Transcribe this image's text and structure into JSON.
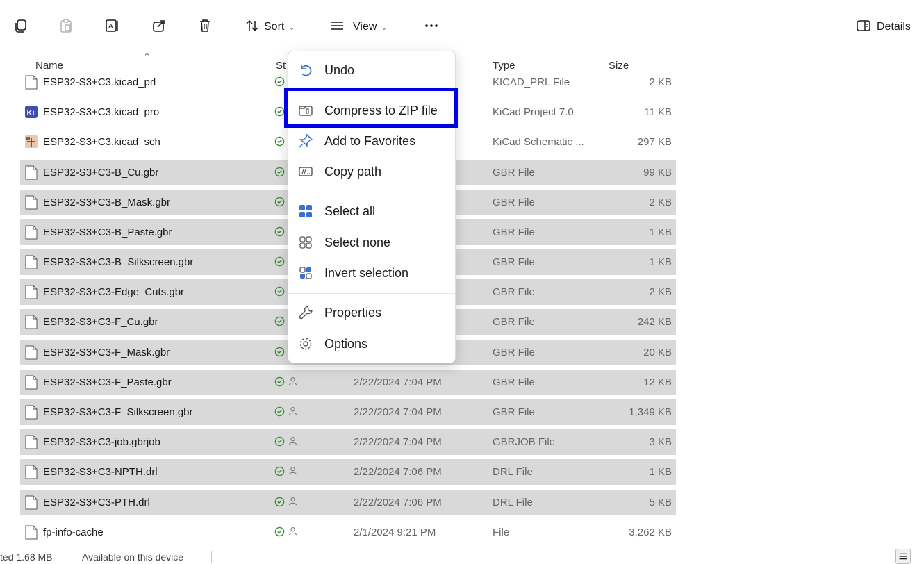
{
  "toolbar": {
    "sort_label": "Sort",
    "view_label": "View",
    "more_label": "...",
    "details_label": "Details",
    "icons": [
      "copy-icon",
      "paste-icon",
      "rename-icon",
      "share-icon",
      "delete-icon",
      "sort-icon",
      "view-icon",
      "more-icon",
      "details-pane-icon"
    ]
  },
  "columns": {
    "name": "Name",
    "status": "St",
    "type": "Type",
    "size": "Size"
  },
  "files": [
    {
      "name": "ESP32-S3+C3.kicad_prl",
      "date": "",
      "type": "KICAD_PRL File",
      "size": "2 KB",
      "selected": false,
      "icon": "blank-file-icon"
    },
    {
      "name": "ESP32-S3+C3.kicad_pro",
      "date": "",
      "type": "KiCad Project 7.0",
      "size": "11 KB",
      "selected": false,
      "icon": "kicad-project-icon"
    },
    {
      "name": "ESP32-S3+C3.kicad_sch",
      "date": "",
      "type": "KiCad Schematic ...",
      "size": "297 KB",
      "selected": false,
      "icon": "kicad-schematic-icon"
    },
    {
      "name": "ESP32-S3+C3-B_Cu.gbr",
      "date": "",
      "type": "GBR File",
      "size": "99 KB",
      "selected": true,
      "icon": "file-icon"
    },
    {
      "name": "ESP32-S3+C3-B_Mask.gbr",
      "date": "",
      "type": "GBR File",
      "size": "2 KB",
      "selected": true,
      "icon": "file-icon"
    },
    {
      "name": "ESP32-S3+C3-B_Paste.gbr",
      "date": "",
      "type": "GBR File",
      "size": "1 KB",
      "selected": true,
      "icon": "file-icon"
    },
    {
      "name": "ESP32-S3+C3-B_Silkscreen.gbr",
      "date": "",
      "type": "GBR File",
      "size": "1 KB",
      "selected": true,
      "icon": "file-icon"
    },
    {
      "name": "ESP32-S3+C3-Edge_Cuts.gbr",
      "date": "",
      "type": "GBR File",
      "size": "2 KB",
      "selected": true,
      "icon": "file-icon"
    },
    {
      "name": "ESP32-S3+C3-F_Cu.gbr",
      "date": "",
      "type": "GBR File",
      "size": "242 KB",
      "selected": true,
      "icon": "file-icon"
    },
    {
      "name": "ESP32-S3+C3-F_Mask.gbr",
      "date": "",
      "type": "GBR File",
      "size": "20 KB",
      "selected": true,
      "icon": "file-icon"
    },
    {
      "name": "ESP32-S3+C3-F_Paste.gbr",
      "date": "2/22/2024 7:04 PM",
      "type": "GBR File",
      "size": "12 KB",
      "selected": true,
      "icon": "file-icon"
    },
    {
      "name": "ESP32-S3+C3-F_Silkscreen.gbr",
      "date": "2/22/2024 7:04 PM",
      "type": "GBR File",
      "size": "1,349 KB",
      "selected": true,
      "icon": "file-icon"
    },
    {
      "name": "ESP32-S3+C3-job.gbrjob",
      "date": "2/22/2024 7:04 PM",
      "type": "GBRJOB File",
      "size": "3 KB",
      "selected": true,
      "icon": "file-icon"
    },
    {
      "name": "ESP32-S3+C3-NPTH.drl",
      "date": "2/22/2024 7:06 PM",
      "type": "DRL File",
      "size": "1 KB",
      "selected": true,
      "icon": "file-icon"
    },
    {
      "name": "ESP32-S3+C3-PTH.drl",
      "date": "2/22/2024 7:06 PM",
      "type": "DRL File",
      "size": "5 KB",
      "selected": true,
      "icon": "file-icon"
    },
    {
      "name": "fp-info-cache",
      "date": "2/1/2024 9:21 PM",
      "type": "File",
      "size": "3,262 KB",
      "selected": false,
      "icon": "file-icon"
    }
  ],
  "context_menu": {
    "items": [
      {
        "label": "Undo",
        "icon": "undo-icon"
      },
      {
        "label": "Compress to ZIP file",
        "icon": "zip-icon"
      },
      {
        "label": "Add to Favorites",
        "icon": "pin-icon"
      },
      {
        "label": "Copy path",
        "icon": "copy-path-icon"
      },
      {
        "label": "Select all",
        "icon": "select-all-icon"
      },
      {
        "label": "Select none",
        "icon": "select-none-icon"
      },
      {
        "label": "Invert selection",
        "icon": "invert-selection-icon"
      },
      {
        "label": "Properties",
        "icon": "properties-icon"
      },
      {
        "label": "Options",
        "icon": "options-icon"
      }
    ]
  },
  "statusbar": {
    "selected_size": "ted  1.68 MB",
    "availability": "Available on this device"
  },
  "colors": {
    "selection_bg": "#d9d9d9",
    "highlight_border": "#0000e6",
    "status_green": "#3a8f3a"
  }
}
